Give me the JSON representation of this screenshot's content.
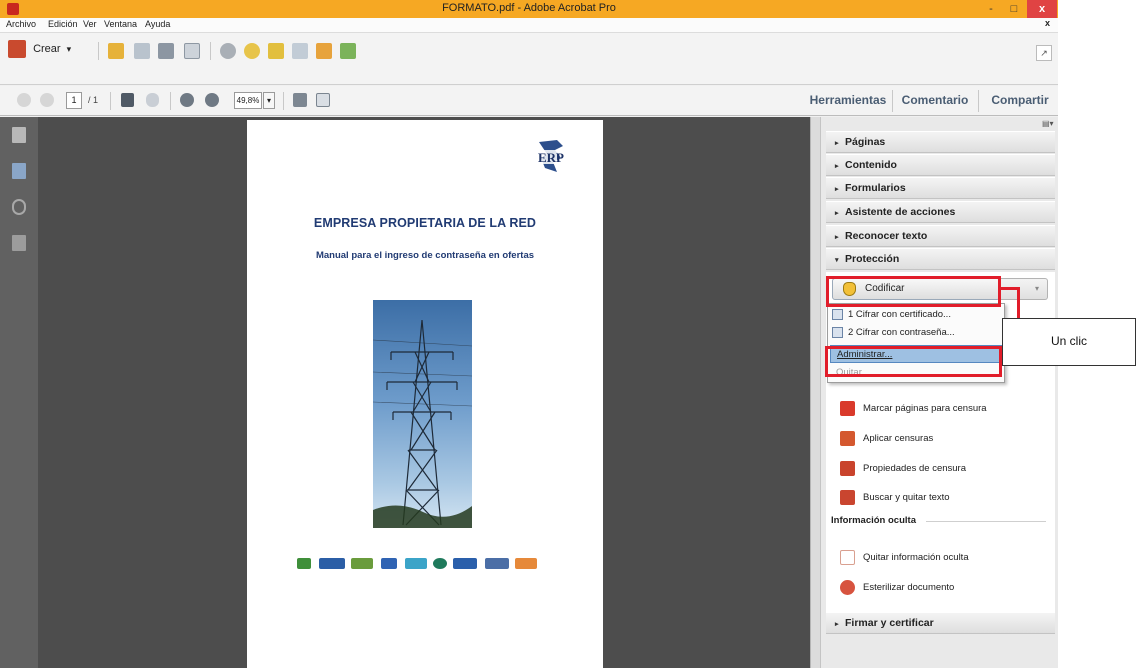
{
  "window": {
    "title": "FORMATO.pdf - Adobe Acrobat Pro",
    "minimize": "-",
    "maximize": "□",
    "close": "x"
  },
  "menu": {
    "items": [
      "Archivo",
      "Edición",
      "Ver",
      "Ventana",
      "Ayuda"
    ],
    "close": "x"
  },
  "toolbar": {
    "crear_label": "Crear",
    "crear_arrow": "▾",
    "page_current": "1",
    "page_total": "/ 1",
    "zoom": "49,8%",
    "zoom_arrow": "▾"
  },
  "right_tabs": {
    "herramientas": "Herramientas",
    "comentario": "Comentario",
    "compartir": "Compartir"
  },
  "document": {
    "logo_text": "ERP",
    "title": "EMPRESA PROPIETARIA DE LA RED",
    "subtitle": "Manual para el ingreso de contraseña en ofertas",
    "partner_logos": [
      "CFE",
      "ETESA",
      "enee",
      "ICE",
      "ENATREL",
      "isa",
      "CEL",
      "Enel"
    ]
  },
  "tools_panel": {
    "sections": [
      {
        "label": "Páginas",
        "state": "collapsed"
      },
      {
        "label": "Contenido",
        "state": "collapsed"
      },
      {
        "label": "Formularios",
        "state": "collapsed"
      },
      {
        "label": "Asistente de acciones",
        "state": "collapsed"
      },
      {
        "label": "Reconocer texto",
        "state": "collapsed"
      },
      {
        "label": "Protección",
        "state": "expanded"
      },
      {
        "label": "Firmar y certificar",
        "state": "collapsed"
      }
    ],
    "collapsed_glyph": "▸",
    "expanded_glyph": "▾",
    "codificar_label": "Codificar",
    "codificar_arrow": "▾",
    "dropdown": [
      {
        "label": "1 Cifrar con certificado...",
        "state": "normal"
      },
      {
        "label": "2 Cifrar con contraseña...",
        "state": "normal"
      },
      {
        "label": "Administrar...",
        "state": "selected"
      },
      {
        "label": "Quitar",
        "state": "disabled"
      }
    ],
    "tools": [
      {
        "label": "Marcar páginas para censura",
        "icon": "redact-mark-icon",
        "color": "#d93a2b"
      },
      {
        "label": "Aplicar censuras",
        "icon": "redact-apply-icon",
        "color": "#d4582f"
      },
      {
        "label": "Propiedades de censura",
        "icon": "redact-properties-icon",
        "color": "#c9432c"
      },
      {
        "label": "Buscar y quitar texto",
        "icon": "search-remove-text-icon",
        "color": "#c9452f"
      }
    ],
    "hidden_info_title": "Información oculta",
    "hidden_tools": [
      {
        "label": "Quitar información oculta",
        "icon": "remove-hidden-info-icon",
        "color": "#e3b5a8"
      },
      {
        "label": "Esterilizar documento",
        "icon": "sanitize-document-icon",
        "color": "#d7533f"
      }
    ]
  },
  "annotation": {
    "callout_text": "Un clic",
    "highlight_color": "#e11d2a"
  }
}
